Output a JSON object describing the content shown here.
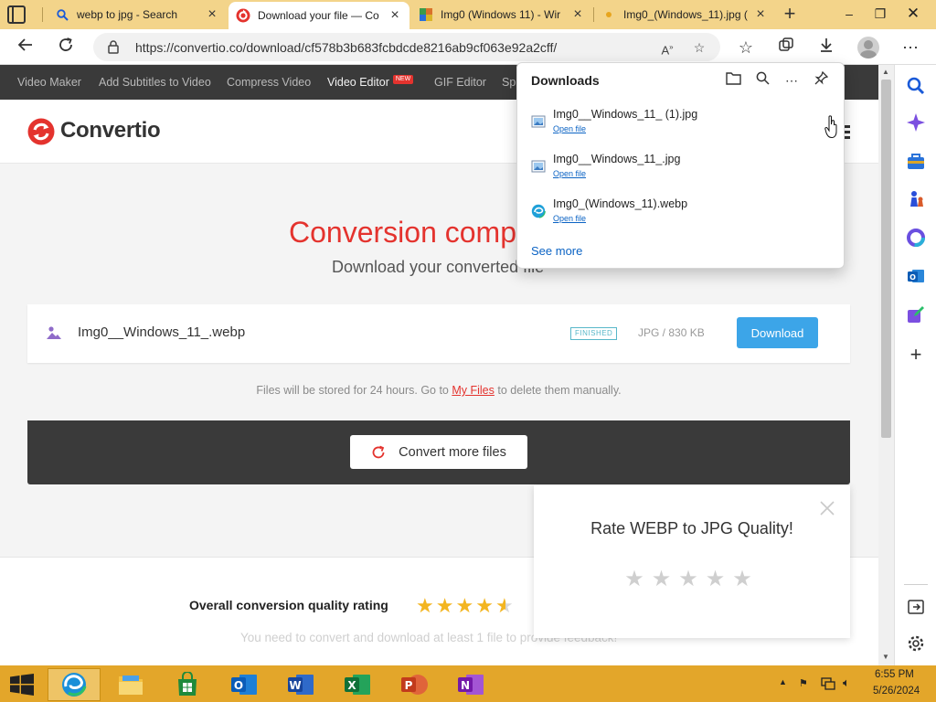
{
  "browser": {
    "tabs": [
      {
        "label": "webp to jpg - Search",
        "favicon": "search-icon"
      },
      {
        "label": "Download your file — Co",
        "favicon": "convertio-logo-icon",
        "active": true
      },
      {
        "label": "Img0 (Windows 11) - Wir",
        "favicon": "image-icon"
      },
      {
        "label": "Img0_(Windows_11).jpg (",
        "favicon": "image-dot-icon"
      }
    ],
    "url": "https://convertio.co/download/cf578b3b683fcbdcde8216ab9cf063e92a2cff/"
  },
  "site": {
    "nav": [
      "Video Maker",
      "Add Subtitles to Video",
      "Compress Video",
      "Video Editor",
      "GIF Editor",
      "Sp"
    ],
    "new_badge": "NEW",
    "logo_text": "Convertio",
    "hero_title": "Conversion comp",
    "hero_subtitle": "Download your converted file",
    "file": {
      "name": "Img0__Windows_11_.webp",
      "status": "FINISHED",
      "meta": "JPG / 830 KB",
      "download_label": "Download"
    },
    "storage_note": {
      "before": "Files will be stored for 24 hours. Go to ",
      "link": "My Files",
      "after": " to delete them manually."
    },
    "convert_more_label": "Convert more files",
    "rating": {
      "label": "Overall conversion quality rating",
      "stars": "★★★★★",
      "value": 4.5,
      "note": "You need to convert and download at least 1 file to provide feedback!"
    },
    "rate_popup": {
      "title": "Rate WEBP to JPG Quality!",
      "stars": "★★★★★"
    }
  },
  "downloads": {
    "title": "Downloads",
    "items": [
      {
        "name": "Img0__Windows_11_ (1).jpg",
        "action": "Open file",
        "icon": "image-file-icon"
      },
      {
        "name": "Img0__Windows_11_.jpg",
        "action": "Open file",
        "icon": "image-file-icon"
      },
      {
        "name": "Img0_(Windows_11).webp",
        "action": "Open file",
        "icon": "edge-file-icon"
      }
    ],
    "see_more": "See more"
  },
  "taskbar": {
    "apps": [
      "Microsoft Edge",
      "File Explorer",
      "Microsoft Store",
      "Outlook",
      "Word",
      "Excel",
      "PowerPoint",
      "OneNote"
    ],
    "time": "6:55 PM",
    "date": "5/26/2024"
  },
  "colors": {
    "brand_red": "#e4332e",
    "download_blue": "#3ca5e8",
    "tab_strip": "#f3d48a",
    "taskbar": "#e3a62a"
  }
}
